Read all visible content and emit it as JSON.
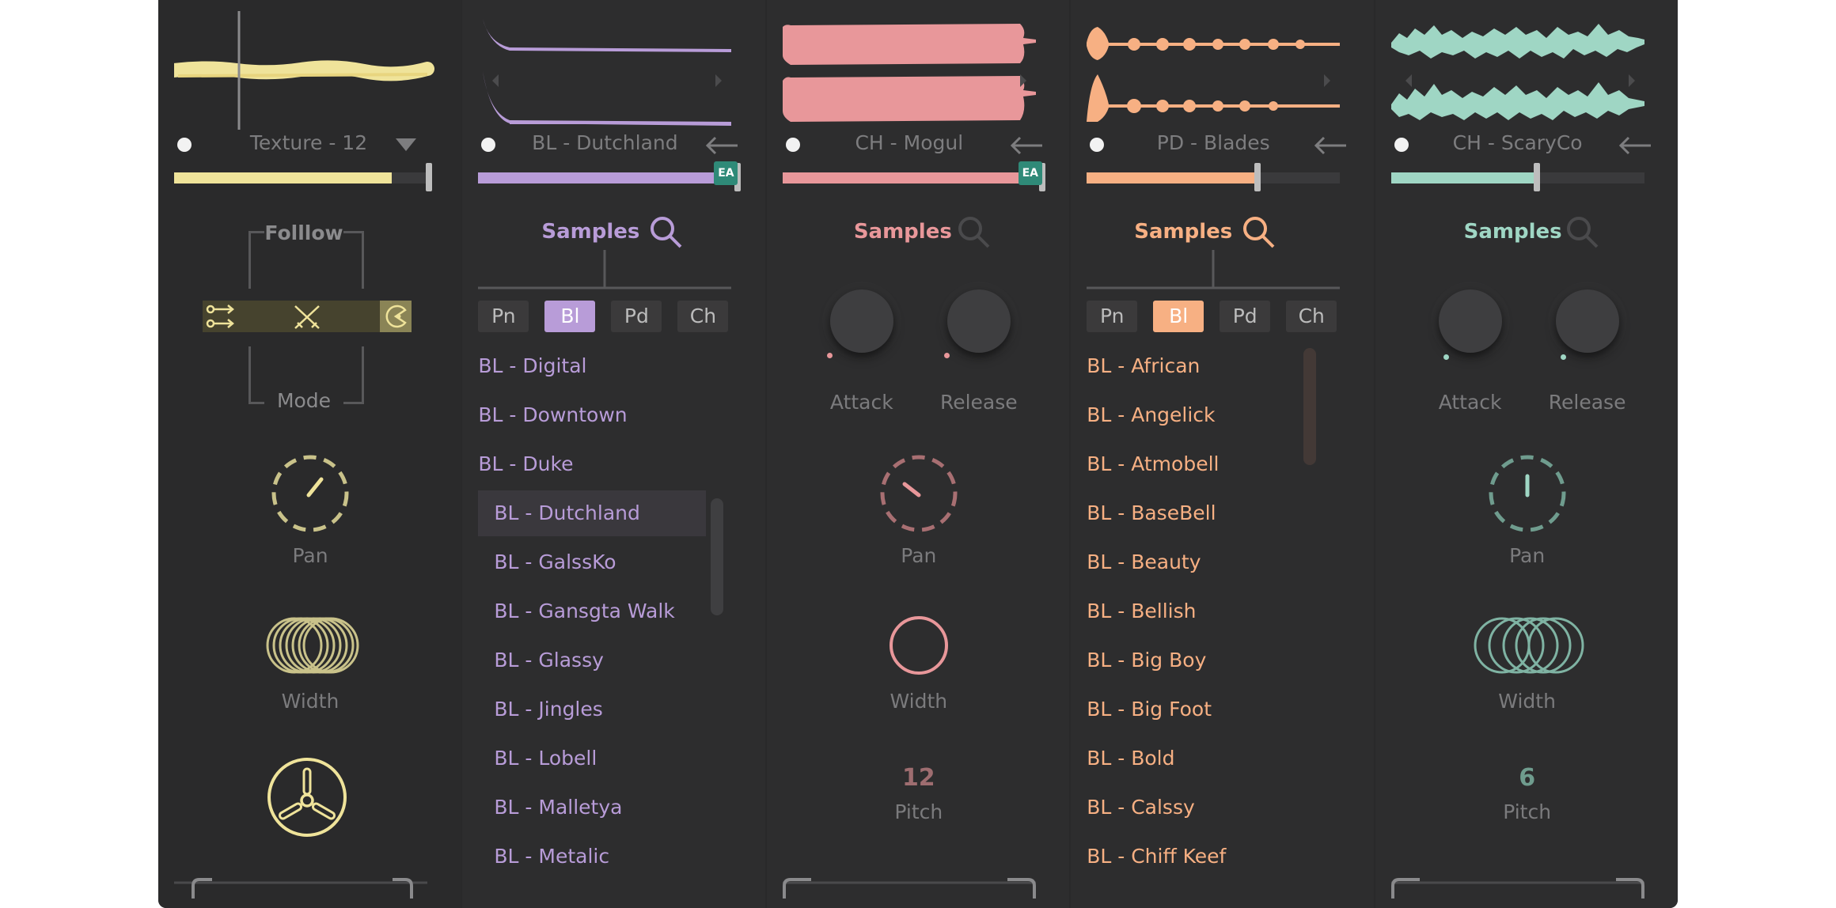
{
  "channels": [
    {
      "sample": "Texture - 12",
      "accent": "#efe39a",
      "slider_level": 0.86
    },
    {
      "sample": "BL - Dutchland",
      "accent": "#b89cd8",
      "slider_level": 0.98
    },
    {
      "sample": "CH - Mogul",
      "accent": "#e8979a",
      "slider_level": 0.98
    },
    {
      "sample": "PD - Blades",
      "accent": "#f7b083",
      "slider_level": 0.68
    },
    {
      "sample": "CH - ScaryCo",
      "accent": "#9fd6c4",
      "slider_level": 0.58
    }
  ],
  "ea_badge": "EA",
  "col1": {
    "follow_label": "Folllow",
    "mode_label": "Mode",
    "pan_label": "Pan",
    "width_label": "Width"
  },
  "col2": {
    "samples_label": "Samples",
    "tabs": [
      "Pn",
      "Bl",
      "Pd",
      "Ch"
    ],
    "active_tab": "Bl",
    "selected_item": "BL - Dutchland",
    "items": [
      "BL - Digital",
      "BL - Downtown",
      "BL - Duke",
      "BL - Dutchland",
      "BL - GalssKo",
      "BL - Gansgta Walk",
      "BL - Glassy",
      "BL - Jingles",
      "BL - Lobell",
      "BL - Malletya",
      "BL - Metalic"
    ]
  },
  "col3": {
    "samples_label": "Samples",
    "attack_label": "Attack",
    "release_label": "Release",
    "pan_label": "Pan",
    "width_label": "Width",
    "pitch_value": "12",
    "pitch_label": "Pitch"
  },
  "col4": {
    "samples_label": "Samples",
    "tabs": [
      "Pn",
      "Bl",
      "Pd",
      "Ch"
    ],
    "active_tab": "Bl",
    "items": [
      "BL - African",
      "BL - Angelick",
      "BL - Atmobell",
      "BL - BaseBell",
      "BL - Beauty",
      "BL - Bellish",
      "BL - Big Boy",
      "BL - Big Foot",
      "BL - Bold",
      "BL - Calssy",
      "BL - Chiff Keef"
    ]
  },
  "col5": {
    "samples_label": "Samples",
    "attack_label": "Attack",
    "release_label": "Release",
    "pan_label": "Pan",
    "width_label": "Width",
    "pitch_value": "6",
    "pitch_label": "Pitch"
  },
  "icons": [
    "arrow-left-icon",
    "search-icon",
    "dropdown-triangle-icon",
    "crossed-swords-icon",
    "split-arrows-icon",
    "pacman-icon",
    "fan-icon",
    "chevron-left-icon",
    "chevron-right-icon"
  ]
}
